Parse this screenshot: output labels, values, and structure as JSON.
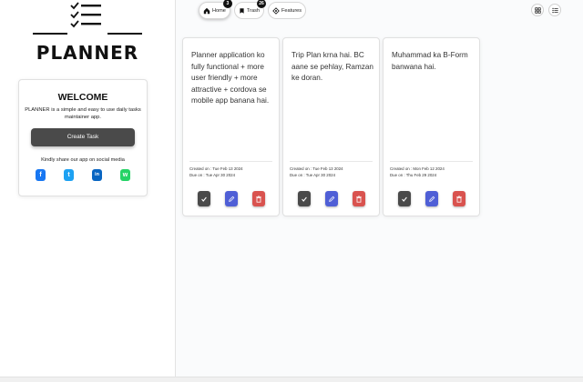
{
  "logo": {
    "text": "PLANNER"
  },
  "welcome": {
    "title": "WELCOME",
    "description": "PLANNER is a simple and easy to use daily tasks maintainer app.",
    "create_button": "Create Task",
    "share_text": "Kindly share our app on social media",
    "socials": [
      {
        "icon": "facebook-icon",
        "glyph": "f",
        "color": "#1877f2"
      },
      {
        "icon": "twitter-icon",
        "glyph": "t",
        "color": "#1da1f2"
      },
      {
        "icon": "linkedin-icon",
        "glyph": "in",
        "color": "#0a66c2"
      },
      {
        "icon": "whatsapp-icon",
        "glyph": "w",
        "color": "#25d366"
      }
    ]
  },
  "nav": {
    "home": {
      "label": "Home",
      "badge": "3"
    },
    "trash": {
      "label": "Trash",
      "badge": "26"
    },
    "features": {
      "label": "Features"
    }
  },
  "tasks": [
    {
      "text": "Planner application ko fully functional + more user friendly + more attractive + cordova se mobile app banana hai.",
      "created": "Created on : Tue Feb 13 2024",
      "due": "Due on : Tue Apr 30 2024"
    },
    {
      "text": "Trip Plan krna hai. BC aane se pehlay, Ramzan ke doran.",
      "created": "Created on : Tue Feb 13 2024",
      "due": "Due on : Tue Apr 30 2024"
    },
    {
      "text": "Muhammad ka B-Form banwana hai.",
      "created": "Created on : Mon Feb 12 2024",
      "due": "Due on : Thu Feb 29 2024"
    }
  ],
  "colors": {
    "done": "#4a4a4a",
    "edit": "#4f5fd6",
    "delete": "#d9534f"
  }
}
